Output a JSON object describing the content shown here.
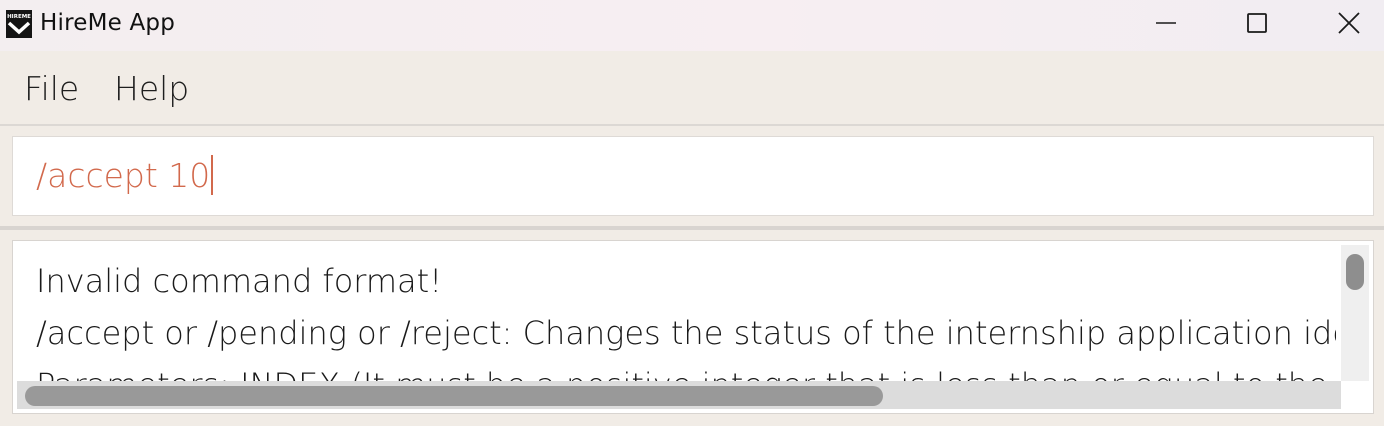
{
  "window": {
    "title": "HireMe App",
    "icon": "hireme-logo-icon",
    "icon_text": "HIREME",
    "controls": [
      "minimize-icon",
      "maximize-icon",
      "close-icon"
    ]
  },
  "menu": {
    "items": [
      {
        "label": "File"
      },
      {
        "label": "Help"
      }
    ]
  },
  "command_box": {
    "value": "/accept 10",
    "text_color": "#d2694c"
  },
  "result_display": {
    "lines": [
      "Invalid command format!",
      "/accept or /pending or /reject: Changes the status of the internship application identified b",
      "Parameters: INDEX (It must be a positive integer that is less than or equal to the total numb"
    ]
  },
  "colors": {
    "background": "#f1ece6",
    "accent": "#d2694c"
  }
}
